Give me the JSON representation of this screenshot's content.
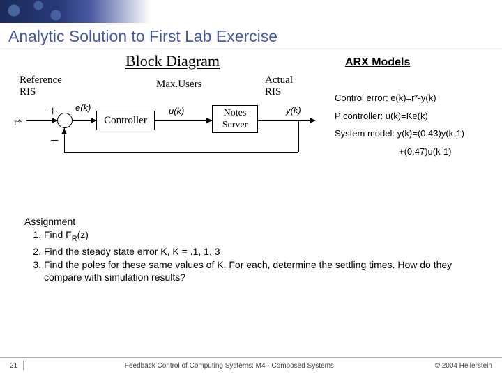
{
  "slide": {
    "title": "Analytic Solution to First Lab Exercise",
    "block_diagram_heading": "Block Diagram",
    "arx_heading": "ARX Models"
  },
  "diagram": {
    "reference_label_line1": "Reference",
    "reference_label_line2": "RIS",
    "r_star": "r*",
    "plus": "+",
    "minus": "−",
    "e_k": "e(k)",
    "controller": "Controller",
    "max_users": "Max.Users",
    "u_k": "u(k)",
    "notes_line1": "Notes",
    "notes_line2": "Server",
    "actual_line1": "Actual",
    "actual_line2": "RIS",
    "y_k": "y(k)"
  },
  "arx": {
    "line1": "Control error: e(k)=r*-y(k)",
    "line2": "P controller: u(k)=Ke(k)",
    "line3": "System model: y(k)=(0.43)y(k-1)",
    "line3b": "+(0.47)u(k-1)"
  },
  "assignment": {
    "heading": "Assignment",
    "item1_pre": "Find F",
    "item1_sub": "R",
    "item1_post": "(z)",
    "item2": "Find the steady state error K, K = .1, 1, 3",
    "item3": "Find the poles for these same values of K. For each, determine the settling times. How do they compare with simulation results?"
  },
  "footer": {
    "page": "21",
    "center": "Feedback Control of Computing Systems: M4 - Composed Systems",
    "right": "© 2004 Hellerstein"
  }
}
